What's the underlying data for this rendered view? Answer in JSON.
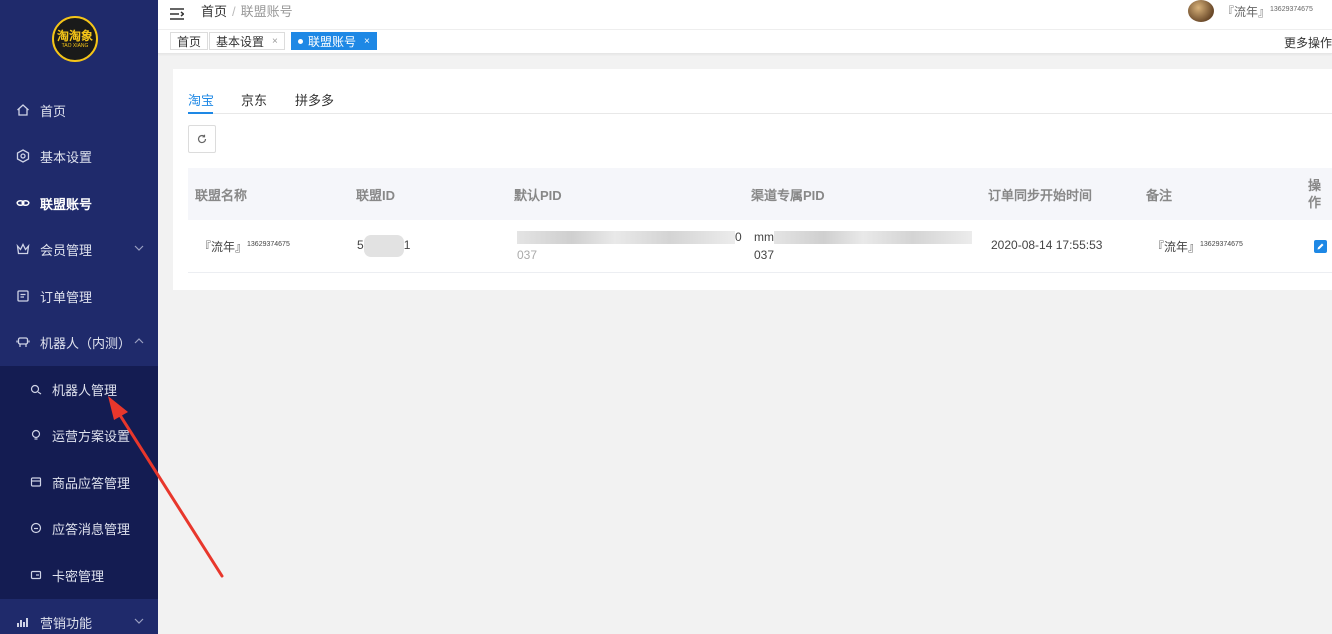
{
  "brand": {
    "logo_text": "淘淘象",
    "logo_sub": "TAO XIANG"
  },
  "sidebar": {
    "items": [
      {
        "label": "首页",
        "icon": "home-icon"
      },
      {
        "label": "基本设置",
        "icon": "settings-icon"
      },
      {
        "label": "联盟账号",
        "icon": "link-icon"
      },
      {
        "label": "会员管理",
        "icon": "crown-icon"
      },
      {
        "label": "订单管理",
        "icon": "order-icon"
      },
      {
        "label": "机器人（内测）",
        "icon": "robot-icon"
      },
      {
        "label": "营销功能",
        "icon": "chart-icon"
      }
    ],
    "subitems": [
      {
        "label": "机器人管理",
        "icon": "robot-manage-icon"
      },
      {
        "label": "运营方案设置",
        "icon": "bulb-icon"
      },
      {
        "label": "商品应答管理",
        "icon": "goods-icon"
      },
      {
        "label": "应答消息管理",
        "icon": "message-icon"
      },
      {
        "label": "卡密管理",
        "icon": "card-icon"
      }
    ]
  },
  "header": {
    "breadcrumb_home": "首页",
    "breadcrumb_sep": "/",
    "breadcrumb_current": "联盟账号",
    "user_name": "『流年』",
    "user_sup": "13629374675"
  },
  "tabs": [
    {
      "label": "首页"
    },
    {
      "label": "基本设置",
      "close": "×"
    },
    {
      "label": "联盟账号",
      "close": "×"
    }
  ],
  "more_ops": "更多操作",
  "platform_tabs": [
    "淘宝",
    "京东",
    "拼多多"
  ],
  "table": {
    "headers": [
      "联盟名称",
      "联盟ID",
      "默认PID",
      "渠道专属PID",
      "订单同步开始时间",
      "备注",
      "操作"
    ],
    "row": {
      "name": "『流年』",
      "name_sup": "13629374675",
      "id_start": "5",
      "id_end": "1",
      "default_pid_end": "0",
      "default_pid_line2": "037",
      "channel_pid_start": "mm",
      "channel_pid_line2": "037",
      "sync_time": "2020-08-14 17:55:53",
      "remark": "『流年』",
      "remark_sup": "13629374675"
    }
  },
  "colors": {
    "sidebar": "#1f2a6b",
    "submenu": "#141c52",
    "accent": "#1e88e5",
    "arrow": "#e8372c"
  }
}
